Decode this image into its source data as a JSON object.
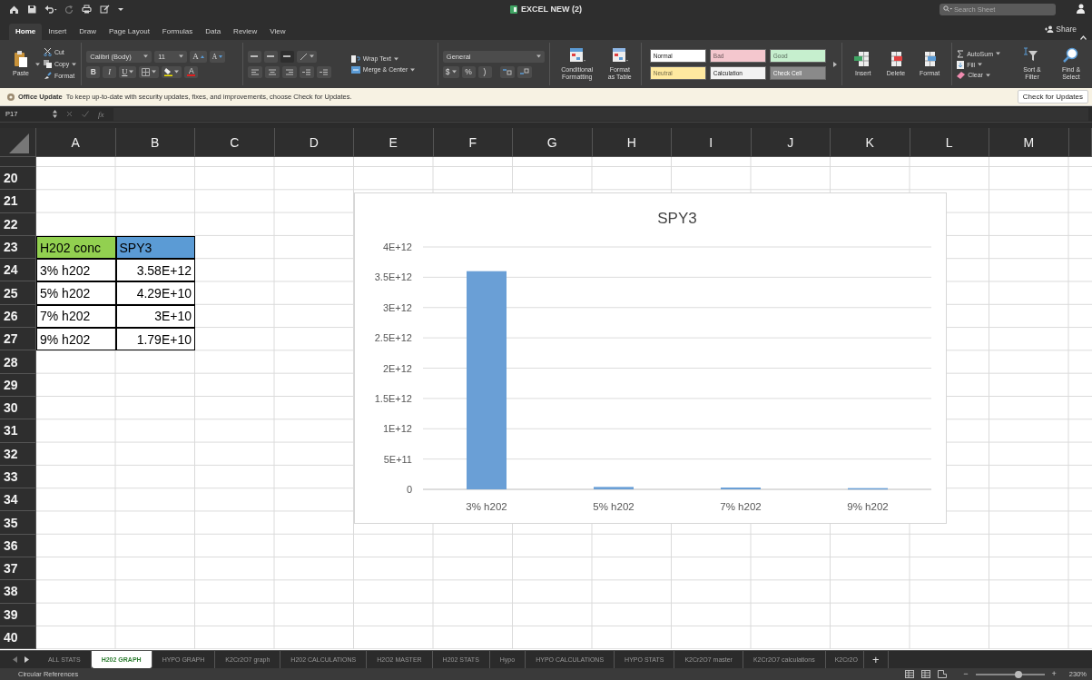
{
  "window": {
    "title": "EXCEL NEW (2)",
    "search": {
      "placeholder": "Search Sheet"
    }
  },
  "ribbon_tabs": [
    {
      "label": "Home",
      "selected": true
    },
    {
      "label": "Insert",
      "selected": false
    },
    {
      "label": "Draw",
      "selected": false
    },
    {
      "label": "Page Layout",
      "selected": false
    },
    {
      "label": "Formulas",
      "selected": false
    },
    {
      "label": "Data",
      "selected": false
    },
    {
      "label": "Review",
      "selected": false
    },
    {
      "label": "View",
      "selected": false
    }
  ],
  "share": "Share",
  "ribbon": {
    "clipboard": {
      "paste": "Paste",
      "cut": "Cut",
      "copy": "Copy",
      "format": "Format"
    },
    "font": {
      "name": "Calibri (Body)",
      "size": "11",
      "grow": "A",
      "shrink": "A",
      "bold": "B",
      "italic": "I",
      "underline": "U",
      "font_color": "A"
    },
    "alignment": {
      "wrap": "Wrap Text",
      "merge": "Merge & Center"
    },
    "number": {
      "format": "General",
      "currency": "$",
      "percent": "%",
      "comma": ")"
    },
    "conditional_formatting": "Conditional Formatting",
    "format_as_table": "Format as Table",
    "styles": [
      {
        "label": "Normal",
        "color": "#ffffff"
      },
      {
        "label": "Bad",
        "color": "#f4c7ce"
      },
      {
        "label": "Good",
        "color": "#c6efce"
      },
      {
        "label": "Neutral",
        "color": "#ffe9a0"
      },
      {
        "label": "Calculation",
        "color": "#f2f2f2"
      },
      {
        "label": "Check Cell",
        "color": "#8a8a8a"
      }
    ],
    "cells": [
      "Insert",
      "Delete",
      "Format"
    ],
    "editing": {
      "autosum": "AutoSum",
      "fill": "Fill",
      "clear": "Clear",
      "sort": "Sort & Filter",
      "find": "Find & Select"
    }
  },
  "update_bar": {
    "message": "**Office Update**  To keep up-to-date with security updates, fixes, and improvements, choose Check for Updates.",
    "button": "Check for Updates"
  },
  "formula_bar": {
    "name_box": "P17",
    "function": "fx"
  },
  "sheet": {
    "columns": [
      "A",
      "B",
      "C",
      "D",
      "E",
      "F",
      "G",
      "H",
      "I",
      "J",
      "K",
      "L",
      "M"
    ],
    "rows": [
      "20",
      "21",
      "22",
      "23",
      "24",
      "25",
      "26",
      "27",
      "28",
      "29",
      "30",
      "31",
      "32",
      "33",
      "34",
      "35",
      "36",
      "37",
      "38",
      "39",
      "40"
    ],
    "table": {
      "header": [
        {
          "text": "H202 conc",
          "color": "#92d050"
        },
        {
          "text": "SPY3",
          "color": "#5b9bd5"
        }
      ],
      "rows": [
        [
          "3% h202",
          "3.58E+12"
        ],
        [
          "5% h202",
          "4.29E+10"
        ],
        [
          "7% h202",
          "3E+10"
        ],
        [
          "9% h202",
          "1.79E+10"
        ]
      ]
    },
    "chart": {
      "chart_data": {
        "type": "bar",
        "title": "SPY3",
        "categories": [
          "3% h202",
          "5% h202",
          "7% h202",
          "9% h202"
        ],
        "series": [
          {
            "color": "#6a9fd6",
            "values": [
              3600000000000.0,
              40000000000.0,
              30000000000.0,
              20000000000.0
            ]
          }
        ],
        "grid": true,
        "ylim": [
          0,
          4000000000000.0
        ],
        "yticks": [
          {
            "value": 0,
            "label": "0"
          },
          {
            "value": 500000000000.0,
            "label": "5E+11"
          },
          {
            "value": 1000000000000.0,
            "label": "1E+12"
          },
          {
            "value": 1500000000000.0,
            "label": "1.5E+12"
          },
          {
            "value": 2000000000000.0,
            "label": "2E+12"
          },
          {
            "value": 2500000000000.0,
            "label": "2.5E+12"
          },
          {
            "value": 3000000000000.0,
            "label": "3E+12"
          },
          {
            "value": 3500000000000.0,
            "label": "3.5E+12"
          },
          {
            "value": 4000000000000.0,
            "label": "4E+12"
          }
        ]
      }
    }
  },
  "sheet_tabs": [
    {
      "label": "ALL STATS",
      "selected": false
    },
    {
      "label": "H202 GRAPH",
      "selected": true
    },
    {
      "label": "HYPO GRAPH",
      "selected": false
    },
    {
      "label": "K2Cr2O7 graph",
      "selected": false
    },
    {
      "label": "H202 CALCULATIONS",
      "selected": false
    },
    {
      "label": "H2O2 MASTER",
      "selected": false
    },
    {
      "label": "H202 STATS",
      "selected": false
    },
    {
      "label": "Hypo",
      "selected": false
    },
    {
      "label": "HYPO CALCULATIONS",
      "selected": false
    },
    {
      "label": "HYPO STATS",
      "selected": false
    },
    {
      "label": "K2Cr2O7 master",
      "selected": false
    },
    {
      "label": "K2Cr2O7 calculations",
      "selected": false
    },
    {
      "label": "K2Cr2O",
      "selected": false
    }
  ],
  "add_sheet": "+",
  "status_bar": {
    "text": "Circular References",
    "zoom_out": "−",
    "zoom_in": "+",
    "zoom": "230%",
    "zoom_slider": {
      "level": 0.62
    }
  }
}
